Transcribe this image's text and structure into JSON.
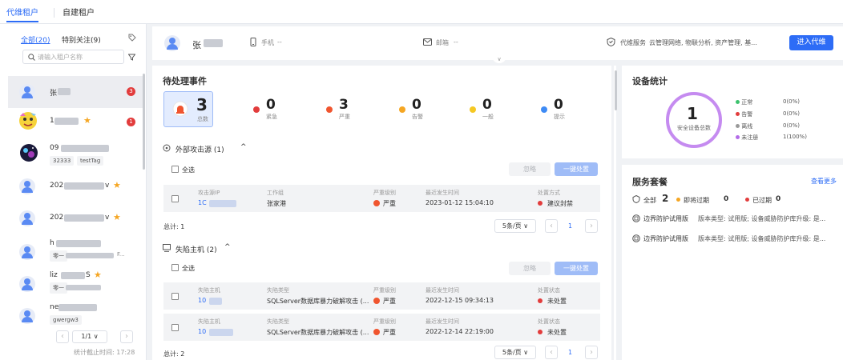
{
  "tabs": {
    "agent": "代维租户",
    "self": "自建租户"
  },
  "sidebar": {
    "filter_all": "全部(20)",
    "filter_follow": "特别关注(9)",
    "search_placeholder": "请输入租户名称",
    "items": [
      {
        "name": "张",
        "badge": "3"
      },
      {
        "name": "1",
        "badge": "1"
      },
      {
        "name": "09",
        "tags": [
          "32333",
          "testTag"
        ]
      },
      {
        "name": "202",
        "suffix": "v"
      },
      {
        "name": "202",
        "suffix": "v"
      },
      {
        "name": "h",
        "sub": "零一",
        "sub2": "F..."
      },
      {
        "name": "liz",
        "suffix": "S",
        "sub": "零一"
      },
      {
        "name": "ne",
        "sub": "gwergw3"
      }
    ],
    "pager": "1/1",
    "stat_time": "统计截止时间: 17:28"
  },
  "header": {
    "name": "张",
    "phone_label": "手机",
    "phone": "--",
    "email_label": "邮箱",
    "email": "--",
    "service_label": "代维服务",
    "service": "云管理网络, 物联分析, 资产管理, 基...",
    "enter_btn": "进入代维"
  },
  "events": {
    "title": "待处理事件",
    "counts": [
      {
        "num": "3",
        "label": "总数"
      },
      {
        "num": "0",
        "label": "紧急",
        "color": "#e23c3c"
      },
      {
        "num": "3",
        "label": "严重",
        "color": "#f0552f"
      },
      {
        "num": "0",
        "label": "告警",
        "color": "#f5a623"
      },
      {
        "num": "0",
        "label": "一般",
        "color": "#f5c823"
      },
      {
        "num": "0",
        "label": "提示",
        "color": "#3e8bf5"
      }
    ],
    "ext": {
      "title": "外部攻击源 (1)",
      "select_all": "全选",
      "ignore": "忽略",
      "handle": "一键处置",
      "headers": [
        "攻击源IP",
        "工作组",
        "严重级别",
        "最近发生时间",
        "处置方式"
      ],
      "rows": [
        {
          "ip": "1C",
          "group": "张家港",
          "level": "严重",
          "time": "2023-01-12 15:04:10",
          "action": "建议封禁"
        }
      ],
      "total": "总计: 1",
      "page_size": "5条/页",
      "page": "1"
    },
    "fall": {
      "title": "失陷主机 (2)",
      "select_all": "全选",
      "ignore": "忽略",
      "handle": "一键处置",
      "headers": [
        "失陷主机",
        "失陷类型",
        "严重级别",
        "最近发生时间",
        "处置状态"
      ],
      "rows": [
        {
          "host": "10",
          "type": "SQLServer数据库暴力破解攻击 (...",
          "level": "严重",
          "time": "2022-12-15 09:34:13",
          "status": "未处置"
        },
        {
          "host": "10",
          "type": "SQLServer数据库暴力破解攻击 (...",
          "level": "严重",
          "time": "2022-12-14 22:19:00",
          "status": "未处置"
        }
      ],
      "total": "总计: 2",
      "page_size": "5条/页",
      "page": "1"
    }
  },
  "devices": {
    "title": "设备统计",
    "total": "1",
    "total_label": "安全设备总数",
    "legend": [
      {
        "label": "正常",
        "value": "0(0%)",
        "color": "#3cc26d"
      },
      {
        "label": "告警",
        "value": "0(0%)",
        "color": "#e23c3c"
      },
      {
        "label": "离线",
        "value": "0(0%)",
        "color": "#999999"
      },
      {
        "label": "未注册",
        "value": "1(100%)",
        "color": "#b36be8"
      }
    ]
  },
  "services": {
    "title": "服务套餐",
    "more": "查看更多",
    "all_label": "全部",
    "all_num": "2",
    "soon_label": "即将过期",
    "soon_num": "0",
    "expired_label": "已过期",
    "expired_num": "0",
    "items": [
      {
        "name": "边界防护试用版",
        "desc": "版本类型: 试用版; 设备威胁防护库升级: 是..."
      },
      {
        "name": "边界防护试用版",
        "desc": "版本类型: 试用版; 设备威胁防护库升级: 是..."
      }
    ]
  }
}
